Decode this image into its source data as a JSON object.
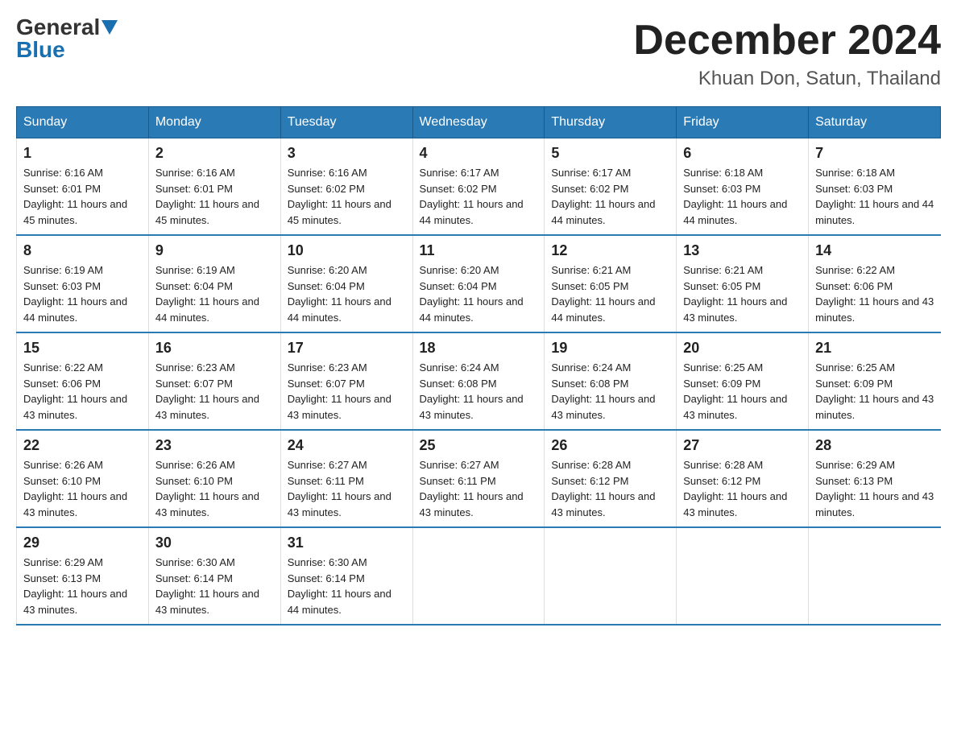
{
  "logo": {
    "general": "General",
    "blue": "Blue"
  },
  "title": "December 2024",
  "location": "Khuan Don, Satun, Thailand",
  "days_of_week": [
    "Sunday",
    "Monday",
    "Tuesday",
    "Wednesday",
    "Thursday",
    "Friday",
    "Saturday"
  ],
  "weeks": [
    [
      {
        "day": "1",
        "sunrise": "6:16 AM",
        "sunset": "6:01 PM",
        "daylight": "11 hours and 45 minutes."
      },
      {
        "day": "2",
        "sunrise": "6:16 AM",
        "sunset": "6:01 PM",
        "daylight": "11 hours and 45 minutes."
      },
      {
        "day": "3",
        "sunrise": "6:16 AM",
        "sunset": "6:02 PM",
        "daylight": "11 hours and 45 minutes."
      },
      {
        "day": "4",
        "sunrise": "6:17 AM",
        "sunset": "6:02 PM",
        "daylight": "11 hours and 44 minutes."
      },
      {
        "day": "5",
        "sunrise": "6:17 AM",
        "sunset": "6:02 PM",
        "daylight": "11 hours and 44 minutes."
      },
      {
        "day": "6",
        "sunrise": "6:18 AM",
        "sunset": "6:03 PM",
        "daylight": "11 hours and 44 minutes."
      },
      {
        "day": "7",
        "sunrise": "6:18 AM",
        "sunset": "6:03 PM",
        "daylight": "11 hours and 44 minutes."
      }
    ],
    [
      {
        "day": "8",
        "sunrise": "6:19 AM",
        "sunset": "6:03 PM",
        "daylight": "11 hours and 44 minutes."
      },
      {
        "day": "9",
        "sunrise": "6:19 AM",
        "sunset": "6:04 PM",
        "daylight": "11 hours and 44 minutes."
      },
      {
        "day": "10",
        "sunrise": "6:20 AM",
        "sunset": "6:04 PM",
        "daylight": "11 hours and 44 minutes."
      },
      {
        "day": "11",
        "sunrise": "6:20 AM",
        "sunset": "6:04 PM",
        "daylight": "11 hours and 44 minutes."
      },
      {
        "day": "12",
        "sunrise": "6:21 AM",
        "sunset": "6:05 PM",
        "daylight": "11 hours and 44 minutes."
      },
      {
        "day": "13",
        "sunrise": "6:21 AM",
        "sunset": "6:05 PM",
        "daylight": "11 hours and 43 minutes."
      },
      {
        "day": "14",
        "sunrise": "6:22 AM",
        "sunset": "6:06 PM",
        "daylight": "11 hours and 43 minutes."
      }
    ],
    [
      {
        "day": "15",
        "sunrise": "6:22 AM",
        "sunset": "6:06 PM",
        "daylight": "11 hours and 43 minutes."
      },
      {
        "day": "16",
        "sunrise": "6:23 AM",
        "sunset": "6:07 PM",
        "daylight": "11 hours and 43 minutes."
      },
      {
        "day": "17",
        "sunrise": "6:23 AM",
        "sunset": "6:07 PM",
        "daylight": "11 hours and 43 minutes."
      },
      {
        "day": "18",
        "sunrise": "6:24 AM",
        "sunset": "6:08 PM",
        "daylight": "11 hours and 43 minutes."
      },
      {
        "day": "19",
        "sunrise": "6:24 AM",
        "sunset": "6:08 PM",
        "daylight": "11 hours and 43 minutes."
      },
      {
        "day": "20",
        "sunrise": "6:25 AM",
        "sunset": "6:09 PM",
        "daylight": "11 hours and 43 minutes."
      },
      {
        "day": "21",
        "sunrise": "6:25 AM",
        "sunset": "6:09 PM",
        "daylight": "11 hours and 43 minutes."
      }
    ],
    [
      {
        "day": "22",
        "sunrise": "6:26 AM",
        "sunset": "6:10 PM",
        "daylight": "11 hours and 43 minutes."
      },
      {
        "day": "23",
        "sunrise": "6:26 AM",
        "sunset": "6:10 PM",
        "daylight": "11 hours and 43 minutes."
      },
      {
        "day": "24",
        "sunrise": "6:27 AM",
        "sunset": "6:11 PM",
        "daylight": "11 hours and 43 minutes."
      },
      {
        "day": "25",
        "sunrise": "6:27 AM",
        "sunset": "6:11 PM",
        "daylight": "11 hours and 43 minutes."
      },
      {
        "day": "26",
        "sunrise": "6:28 AM",
        "sunset": "6:12 PM",
        "daylight": "11 hours and 43 minutes."
      },
      {
        "day": "27",
        "sunrise": "6:28 AM",
        "sunset": "6:12 PM",
        "daylight": "11 hours and 43 minutes."
      },
      {
        "day": "28",
        "sunrise": "6:29 AM",
        "sunset": "6:13 PM",
        "daylight": "11 hours and 43 minutes."
      }
    ],
    [
      {
        "day": "29",
        "sunrise": "6:29 AM",
        "sunset": "6:13 PM",
        "daylight": "11 hours and 43 minutes."
      },
      {
        "day": "30",
        "sunrise": "6:30 AM",
        "sunset": "6:14 PM",
        "daylight": "11 hours and 43 minutes."
      },
      {
        "day": "31",
        "sunrise": "6:30 AM",
        "sunset": "6:14 PM",
        "daylight": "11 hours and 44 minutes."
      },
      null,
      null,
      null,
      null
    ]
  ]
}
